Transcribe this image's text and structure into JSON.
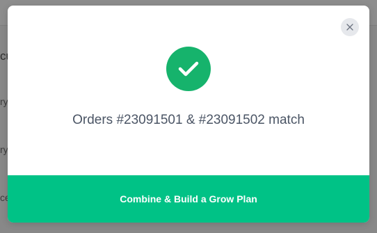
{
  "background": {
    "fragments": {
      "heading": "cu",
      "line1": "ry",
      "line2": "ry",
      "line3": "ce"
    }
  },
  "modal": {
    "close_icon": "close-icon",
    "status_icon": "check-icon",
    "message": "Orders #23091501 & #23091502 match",
    "primary_action_label": "Combine & Build a Grow Plan"
  },
  "colors": {
    "success": "#16b36c",
    "primary_button": "#00c286",
    "message_text": "#4b5565",
    "overlay": "#888888"
  }
}
